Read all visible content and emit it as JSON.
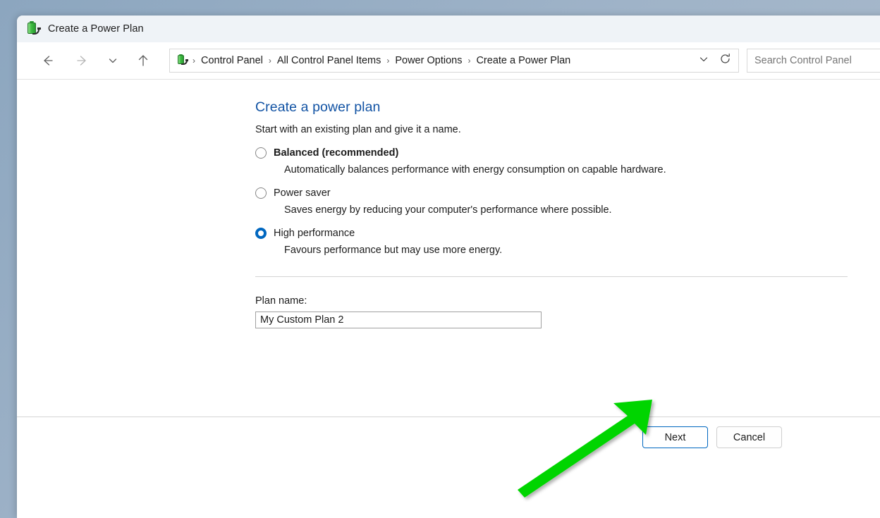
{
  "window": {
    "title": "Create a Power Plan",
    "title_icon": "power-plan-icon"
  },
  "toolbar": {
    "back_icon": "arrow-left-icon",
    "forward_icon": "arrow-right-icon",
    "recent_icon": "chevron-down-icon",
    "up_icon": "arrow-up-icon",
    "refresh_icon": "refresh-icon",
    "dropdown_icon": "chevron-down-icon"
  },
  "breadcrumb": {
    "icon": "power-plan-icon",
    "separator": "›",
    "items": [
      "Control Panel",
      "All Control Panel Items",
      "Power Options",
      "Create a Power Plan"
    ]
  },
  "search": {
    "placeholder": "Search Control Panel",
    "value": "",
    "icon": "search-icon"
  },
  "page": {
    "title": "Create a power plan",
    "subtitle": "Start with an existing plan and give it a name.",
    "options": [
      {
        "label": "Balanced (recommended)",
        "description": "Automatically balances performance with energy consumption on capable hardware.",
        "selected": false,
        "bold": true
      },
      {
        "label": "Power saver",
        "description": "Saves energy by reducing your computer's performance where possible.",
        "selected": false,
        "bold": false
      },
      {
        "label": "High performance",
        "description": "Favours performance but may use more energy.",
        "selected": true,
        "bold": false
      }
    ],
    "plan_name_label": "Plan name:",
    "plan_name_value": "My Custom Plan 2"
  },
  "footer": {
    "next_label": "Next",
    "cancel_label": "Cancel"
  },
  "annotation": {
    "arrow_color": "#00d500",
    "target": "next-button"
  },
  "colors": {
    "accent": "#0067c0",
    "heading": "#1253a4",
    "titlebar": "#eff3f7",
    "desktop": "#9fb3c8"
  }
}
